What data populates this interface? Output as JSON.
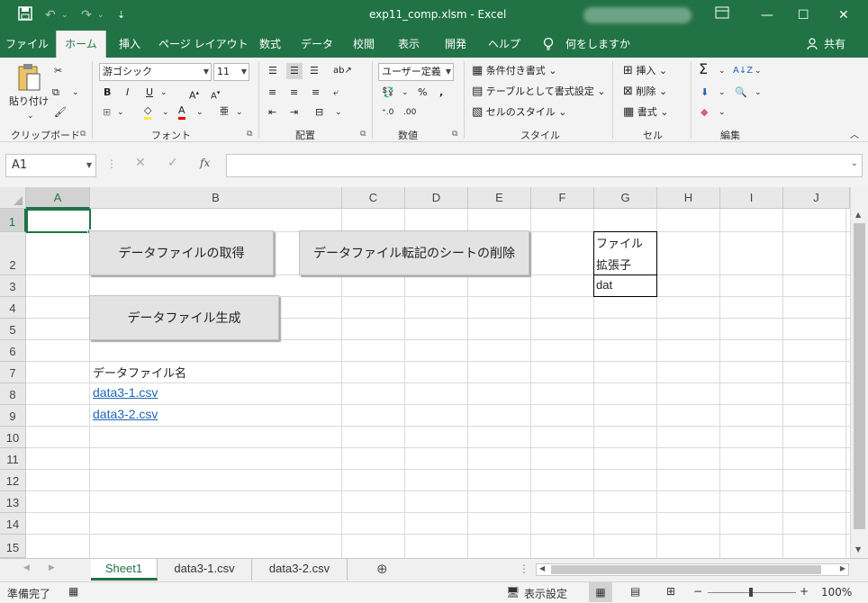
{
  "window": {
    "title": "exp11_comp.xlsm  -  Excel",
    "save_icon": "save-icon",
    "undo_icon": "undo-icon",
    "redo_icon": "redo-icon",
    "ribbon_display_icon": "ribbon-display-icon",
    "minimize": "—",
    "restore": "☐",
    "close": "✕"
  },
  "menu": {
    "tabs": [
      "ファイル",
      "ホーム",
      "挿入",
      "ページ レイアウト",
      "数式",
      "データ",
      "校閲",
      "表示",
      "開発",
      "ヘルプ",
      "何をしますか"
    ],
    "active": "ホーム",
    "share": "共有"
  },
  "ribbon": {
    "clipboard": {
      "paste": "貼り付け",
      "label": "クリップボード"
    },
    "font": {
      "name": "游ゴシック",
      "size": "11",
      "label": "フォント"
    },
    "alignment": {
      "label": "配置"
    },
    "number": {
      "format": "ユーザー定義",
      "label": "数値"
    },
    "styles": {
      "conditional": "条件付き書式",
      "table": "テーブルとして書式設定",
      "cell_styles": "セルのスタイル",
      "label": "スタイル"
    },
    "cells": {
      "insert": "挿入",
      "delete": "削除",
      "format": "書式",
      "label": "セル"
    },
    "editing": {
      "label": "編集"
    }
  },
  "formula_bar": {
    "name_box": "A1",
    "formula": "",
    "fx": "fx"
  },
  "columns": [
    "A",
    "B",
    "C",
    "D",
    "E",
    "F",
    "G",
    "H",
    "I",
    "J"
  ],
  "rows": [
    "1",
    "2",
    "3",
    "4",
    "5",
    "6",
    "7",
    "8",
    "9",
    "10",
    "11",
    "12",
    "13",
    "14",
    "15"
  ],
  "sheet": {
    "buttons": {
      "get_data": "データファイルの取得",
      "delete_sheets": "データファイル転記のシートの削除",
      "generate": "データファイル生成"
    },
    "g2_line1": "ファイル",
    "g2_line2": "拡張子",
    "g3": "dat",
    "b7": "データファイル名",
    "b8": "data3-1.csv",
    "b9": "data3-2.csv"
  },
  "sheet_tabs": [
    "Sheet1",
    "data3-1.csv",
    "data3-2.csv"
  ],
  "active_sheet": "Sheet1",
  "status": {
    "ready": "準備完了",
    "display_settings": "表示設定",
    "zoom": "100%",
    "zoom_minus": "−",
    "zoom_plus": "+"
  }
}
